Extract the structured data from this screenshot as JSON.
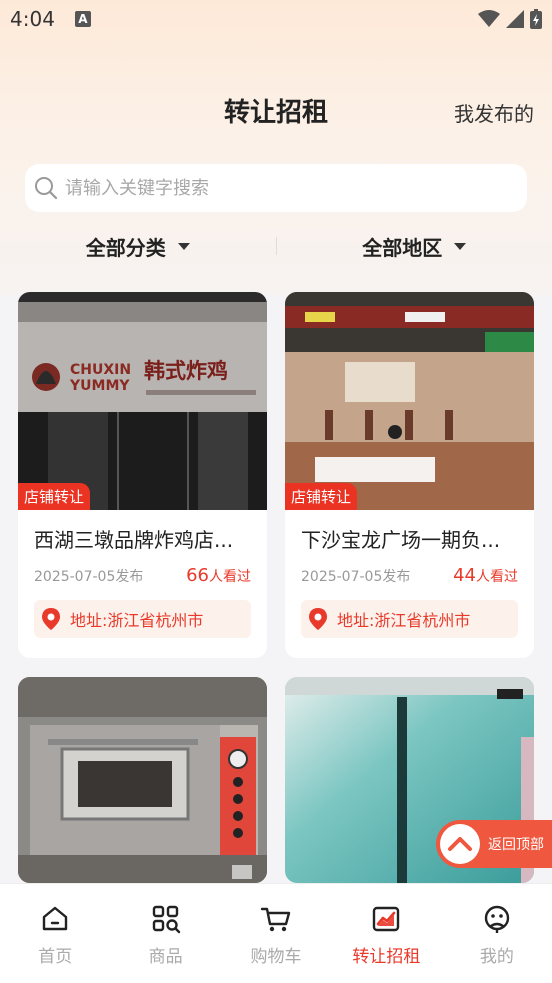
{
  "status_bar": {
    "time": "4:04",
    "notif_letter": "A"
  },
  "header": {
    "title": "转让招租",
    "action": "我发布的"
  },
  "search": {
    "placeholder": "请输入关键字搜索"
  },
  "filters": {
    "category": "全部分类",
    "region": "全部地区"
  },
  "cards": [
    {
      "tag": "店铺转让",
      "title": "西湖三墩品牌炸鸡店...",
      "date": "2025-07-05发布",
      "views": "66",
      "views_suffix": "人看过",
      "address": "地址:浙江省杭州市",
      "sign_en1": "CHUXIN",
      "sign_en2": "YUMMY",
      "sign_cn": "韩式炸鸡"
    },
    {
      "tag": "店铺转让",
      "title": "下沙宝龙广场一期负...",
      "date": "2025-07-05发布",
      "views": "44",
      "views_suffix": "人看过",
      "address": "地址:浙江省杭州市"
    },
    {
      "tag": "",
      "title": "",
      "date": "",
      "views": "",
      "address": ""
    },
    {
      "tag": "",
      "title": "",
      "date": "",
      "views": "",
      "address": ""
    }
  ],
  "back_to_top": {
    "label": "返回顶部"
  },
  "nav": [
    {
      "label": "首页",
      "icon": "home-icon"
    },
    {
      "label": "商品",
      "icon": "grid-search-icon"
    },
    {
      "label": "购物车",
      "icon": "cart-icon"
    },
    {
      "label": "转让招租",
      "icon": "chart-icon",
      "active": true
    },
    {
      "label": "我的",
      "icon": "profile-icon"
    }
  ],
  "colors": {
    "accent": "#e8392b",
    "tag_bg": "#ea3323",
    "address_bg": "#fdf1ec"
  }
}
